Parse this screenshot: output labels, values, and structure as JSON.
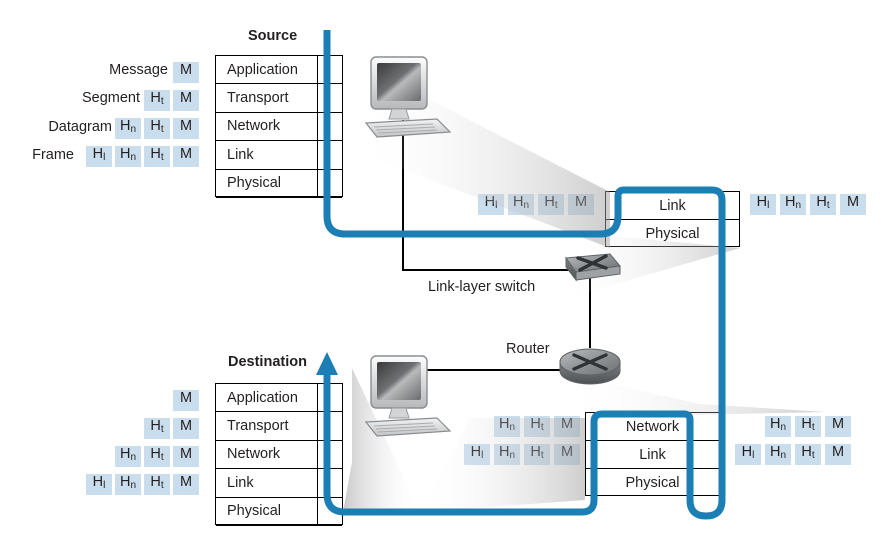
{
  "diagram": {
    "title_source": "Source",
    "title_destination": "Destination",
    "device_switch": "Link-layer switch",
    "device_router": "Router",
    "accent_blue": "#1b7fb5",
    "chip_blue": "#cadded",
    "line_black": "#000000"
  },
  "source_stack": {
    "layers": [
      "Application",
      "Transport",
      "Network",
      "Link",
      "Physical"
    ]
  },
  "destination_stack": {
    "layers": [
      "Application",
      "Transport",
      "Network",
      "Link",
      "Physical"
    ]
  },
  "switch_stack": {
    "layers": [
      "Link",
      "Physical"
    ]
  },
  "router_stack": {
    "layers": [
      "Network",
      "Link",
      "Physical"
    ]
  },
  "pdu_names": {
    "message": "Message",
    "segment": "Segment",
    "datagram": "Datagram",
    "frame": "Frame"
  },
  "headers": {
    "m": "M",
    "ht": "H",
    "ht_sub": "t",
    "hn": "H",
    "hn_sub": "n",
    "hl": "H",
    "hl_sub": "l"
  },
  "source_pdus": [
    {
      "label": "Message",
      "chips": [
        "M"
      ]
    },
    {
      "label": "Segment",
      "chips": [
        "Ht",
        "M"
      ]
    },
    {
      "label": "Datagram",
      "chips": [
        "Hn",
        "Ht",
        "M"
      ]
    },
    {
      "label": "Frame",
      "chips": [
        "Hl",
        "Hn",
        "Ht",
        "M"
      ]
    }
  ],
  "destination_pdus": [
    {
      "label": "",
      "chips": [
        "M"
      ]
    },
    {
      "label": "",
      "chips": [
        "Ht",
        "M"
      ]
    },
    {
      "label": "",
      "chips": [
        "Hn",
        "Ht",
        "M"
      ]
    },
    {
      "label": "",
      "chips": [
        "Hl",
        "Hn",
        "Ht",
        "M"
      ]
    }
  ],
  "switch_pdus": {
    "left": [
      "Hl",
      "Hn",
      "Ht",
      "M"
    ],
    "right": [
      "Hl",
      "Hn",
      "Ht",
      "M"
    ]
  },
  "router_pdus": {
    "left_top": [
      "Hn",
      "Ht",
      "M"
    ],
    "left_bottom": [
      "Hl",
      "Hn",
      "Ht",
      "M"
    ],
    "right_top": [
      "Hn",
      "Ht",
      "M"
    ],
    "right_bottom": [
      "Hl",
      "Hn",
      "Ht",
      "M"
    ]
  }
}
